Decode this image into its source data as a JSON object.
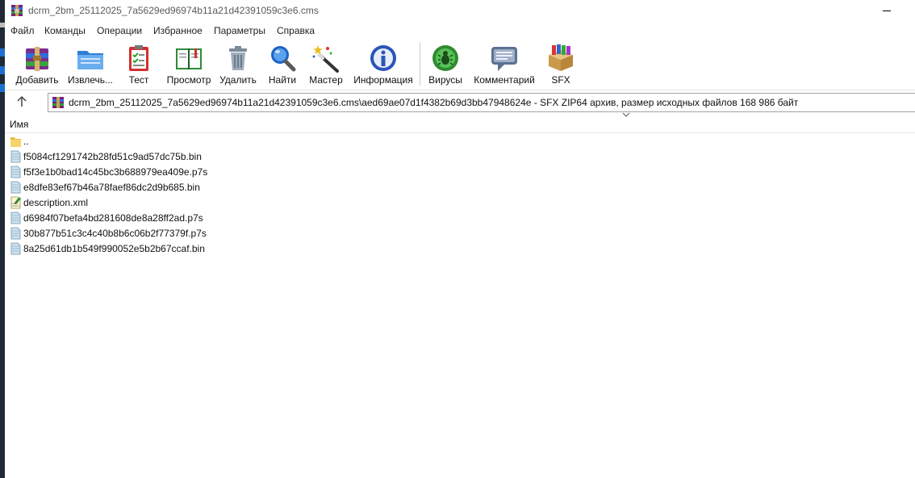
{
  "window": {
    "title": "dcrm_2bm_25112025_7a5629ed96974b11a21d42391059c3e6.cms"
  },
  "menu": [
    "Файл",
    "Команды",
    "Операции",
    "Избранное",
    "Параметры",
    "Справка"
  ],
  "toolbar": {
    "add": "Добавить",
    "extract": "Извлечь...",
    "test": "Тест",
    "view": "Просмотр",
    "delete": "Удалить",
    "find": "Найти",
    "wizard": "Мастер",
    "info": "Информация",
    "virus": "Вирусы",
    "comment": "Комментарий",
    "sfx": "SFX"
  },
  "address": {
    "text": "dcrm_2bm_25112025_7a5629ed96974b11a21d42391059c3e6.cms\\aed69ae07d1f4382b69d3bb47948624e - SFX ZIP64 архив, размер исходных файлов 168 986 байт"
  },
  "list": {
    "column_name": "Имя",
    "items": [
      {
        "name": "..",
        "icon": "folder-icon"
      },
      {
        "name": "f5084cf1291742b28fd51c9ad57dc75b.bin",
        "icon": "file-icon"
      },
      {
        "name": "f5f3e1b0bad14c45bc3b688979ea409e.p7s",
        "icon": "file-icon"
      },
      {
        "name": "e8dfe83ef67b46a78faef86dc2d9b685.bin",
        "icon": "file-icon"
      },
      {
        "name": "description.xml",
        "icon": "xml-file-icon"
      },
      {
        "name": "d6984f07befa4bd281608de8a28ff2ad.p7s",
        "icon": "file-icon"
      },
      {
        "name": "30b877b51c3c4c40b8b6c06b2f77379f.p7s",
        "icon": "file-icon"
      },
      {
        "name": "8a25d61db1b549f990052e5b2b67ccaf.bin",
        "icon": "file-icon"
      }
    ]
  }
}
